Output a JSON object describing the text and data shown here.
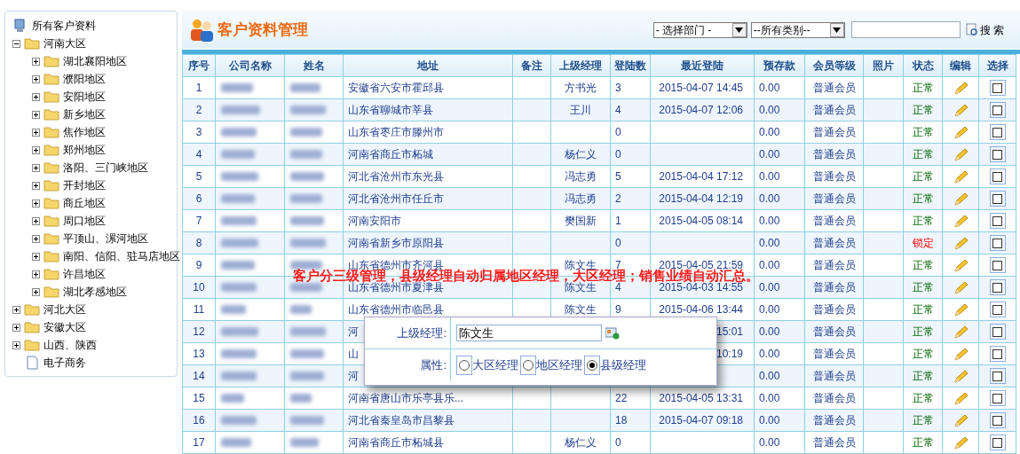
{
  "sidebar": {
    "tree": [
      {
        "label": "所有客户资料",
        "kind": "root",
        "children": [
          {
            "label": "河南大区",
            "kind": "folder",
            "expanded": true,
            "children": [
              {
                "label": "湖北襄阳地区",
                "kind": "folder",
                "expanded": false
              },
              {
                "label": "濮阳地区",
                "kind": "folder",
                "expanded": false
              },
              {
                "label": "安阳地区",
                "kind": "folder",
                "expanded": false
              },
              {
                "label": "新乡地区",
                "kind": "folder",
                "expanded": false
              },
              {
                "label": "焦作地区",
                "kind": "folder",
                "expanded": false
              },
              {
                "label": "郑州地区",
                "kind": "folder",
                "expanded": false
              },
              {
                "label": "洛阳、三门峡地区",
                "kind": "folder",
                "expanded": false
              },
              {
                "label": "开封地区",
                "kind": "folder",
                "expanded": false
              },
              {
                "label": "商丘地区",
                "kind": "folder",
                "expanded": false
              },
              {
                "label": "周口地区",
                "kind": "folder",
                "expanded": false
              },
              {
                "label": "平顶山、漯河地区",
                "kind": "folder",
                "expanded": false
              },
              {
                "label": "南阳、信阳、驻马店地区",
                "kind": "folder",
                "expanded": false
              },
              {
                "label": "许昌地区",
                "kind": "folder",
                "expanded": false
              },
              {
                "label": "湖北孝感地区",
                "kind": "folder",
                "expanded": false
              }
            ]
          },
          {
            "label": "河北大区",
            "kind": "folder",
            "expanded": false
          },
          {
            "label": "安徽大区",
            "kind": "folder",
            "expanded": false
          },
          {
            "label": "山西、陕西",
            "kind": "folder",
            "expanded": false
          },
          {
            "label": "电子商务",
            "kind": "document"
          }
        ]
      }
    ]
  },
  "header": {
    "title": "客户资料管理",
    "department_select": "- 选择部门 -",
    "category_select": "--所有类别--",
    "search_button": "搜 索"
  },
  "table": {
    "columns": [
      "序号",
      "公司名称",
      "姓名",
      "地址",
      "备注",
      "上级经理",
      "登陆数",
      "最近登陆",
      "预存款",
      "会员等级",
      "照片",
      "状态",
      "编辑",
      "选择"
    ],
    "rows": [
      {
        "no": "1",
        "address": "安徽省六安市霍邱县",
        "manager": "方书光",
        "logins": "3",
        "last_login": "2015-04-07 14:45",
        "balance": "0.00",
        "level": "普通会员",
        "status": "正常",
        "locked": false,
        "checked": false
      },
      {
        "no": "2",
        "address": "山东省聊城市莘县",
        "manager": "王川",
        "logins": "4",
        "last_login": "2015-04-07 12:06",
        "balance": "0.00",
        "level": "普通会员",
        "status": "正常",
        "locked": false,
        "checked": false
      },
      {
        "no": "3",
        "address": "山东省枣庄市滕州市",
        "manager": "",
        "logins": "0",
        "last_login": "",
        "balance": "0.00",
        "level": "普通会员",
        "status": "正常",
        "locked": false,
        "checked": false
      },
      {
        "no": "4",
        "address": "河南省商丘市柘城",
        "manager": "杨仁义",
        "logins": "0",
        "last_login": "",
        "balance": "0.00",
        "level": "普通会员",
        "status": "正常",
        "locked": false,
        "checked": false
      },
      {
        "no": "5",
        "address": "河北省沧州市东光县",
        "manager": "冯志勇",
        "logins": "5",
        "last_login": "2015-04-04 17:12",
        "balance": "0.00",
        "level": "普通会员",
        "status": "正常",
        "locked": false,
        "checked": false
      },
      {
        "no": "6",
        "address": "河北省沧州市任丘市",
        "manager": "冯志勇",
        "logins": "2",
        "last_login": "2015-04-04 12:19",
        "balance": "0.00",
        "level": "普通会员",
        "status": "正常",
        "locked": false,
        "checked": false
      },
      {
        "no": "7",
        "address": "河南安阳市",
        "manager": "樊国新",
        "logins": "1",
        "last_login": "2015-04-05 08:14",
        "balance": "0.00",
        "level": "普通会员",
        "status": "正常",
        "locked": false,
        "checked": false
      },
      {
        "no": "8",
        "address": "河南省新乡市原阳县",
        "manager": "",
        "logins": "0",
        "last_login": "",
        "balance": "0.00",
        "level": "普通会员",
        "status": "锁定",
        "locked": true,
        "checked": false
      },
      {
        "no": "9",
        "address": "山东省德州市齐河县",
        "manager": "陈文生",
        "logins": "7",
        "last_login": "2015-04-05 21:59",
        "balance": "0.00",
        "level": "普通会员",
        "status": "正常",
        "locked": false,
        "checked": false
      },
      {
        "no": "10",
        "address": "山东省德州市夏津县",
        "manager": "陈文生",
        "logins": "4",
        "last_login": "2015-04-03 14:55",
        "balance": "0.00",
        "level": "普通会员",
        "status": "正常",
        "locked": false,
        "checked": false
      },
      {
        "no": "11",
        "address": "山东省德州市临邑县",
        "manager": "陈文生",
        "logins": "9",
        "last_login": "2015-04-06 13:44",
        "balance": "0.00",
        "level": "普通会员",
        "status": "正常",
        "locked": false,
        "checked": false
      },
      {
        "no": "12",
        "address": "河",
        "manager": "",
        "logins": "",
        "last_login": "15:01",
        "balance": "0.00",
        "level": "普通会员",
        "status": "正常",
        "locked": false,
        "checked": false
      },
      {
        "no": "13",
        "address": "山",
        "manager": "",
        "logins": "",
        "last_login": "10:19",
        "balance": "0.00",
        "level": "普通会员",
        "status": "正常",
        "locked": false,
        "checked": false
      },
      {
        "no": "14",
        "address": "河",
        "manager": "",
        "logins": "",
        "last_login": "",
        "balance": "0.00",
        "level": "普通会员",
        "status": "正常",
        "locked": false,
        "checked": false
      },
      {
        "no": "15",
        "address": "河南省唐山市乐亭县乐...",
        "manager": "",
        "logins": "22",
        "last_login": "2015-04-05 13:31",
        "balance": "0.00",
        "level": "普通会员",
        "status": "正常",
        "locked": false,
        "checked": false
      },
      {
        "no": "16",
        "address": "河北省秦皇岛市昌黎县",
        "manager": "",
        "logins": "18",
        "last_login": "2015-04-07 09:18",
        "balance": "0.00",
        "level": "普通会员",
        "status": "正常",
        "locked": false,
        "checked": false
      },
      {
        "no": "17",
        "address": "河南省商丘市柘城县",
        "manager": "杨仁义",
        "logins": "0",
        "last_login": "",
        "balance": "0.00",
        "level": "普通会员",
        "status": "正常",
        "locked": false,
        "checked": false
      }
    ]
  },
  "annotation": "客户分三级管理，县级经理自动归属地区经理，大区经理；销售业绩自动汇总。",
  "popup": {
    "manager_label": "上级经理:",
    "manager_value": "陈文生",
    "role_label": "属性:",
    "roles": [
      {
        "label": "大区经理",
        "selected": false
      },
      {
        "label": "地区经理",
        "selected": false
      },
      {
        "label": "县级经理",
        "selected": true
      }
    ]
  }
}
